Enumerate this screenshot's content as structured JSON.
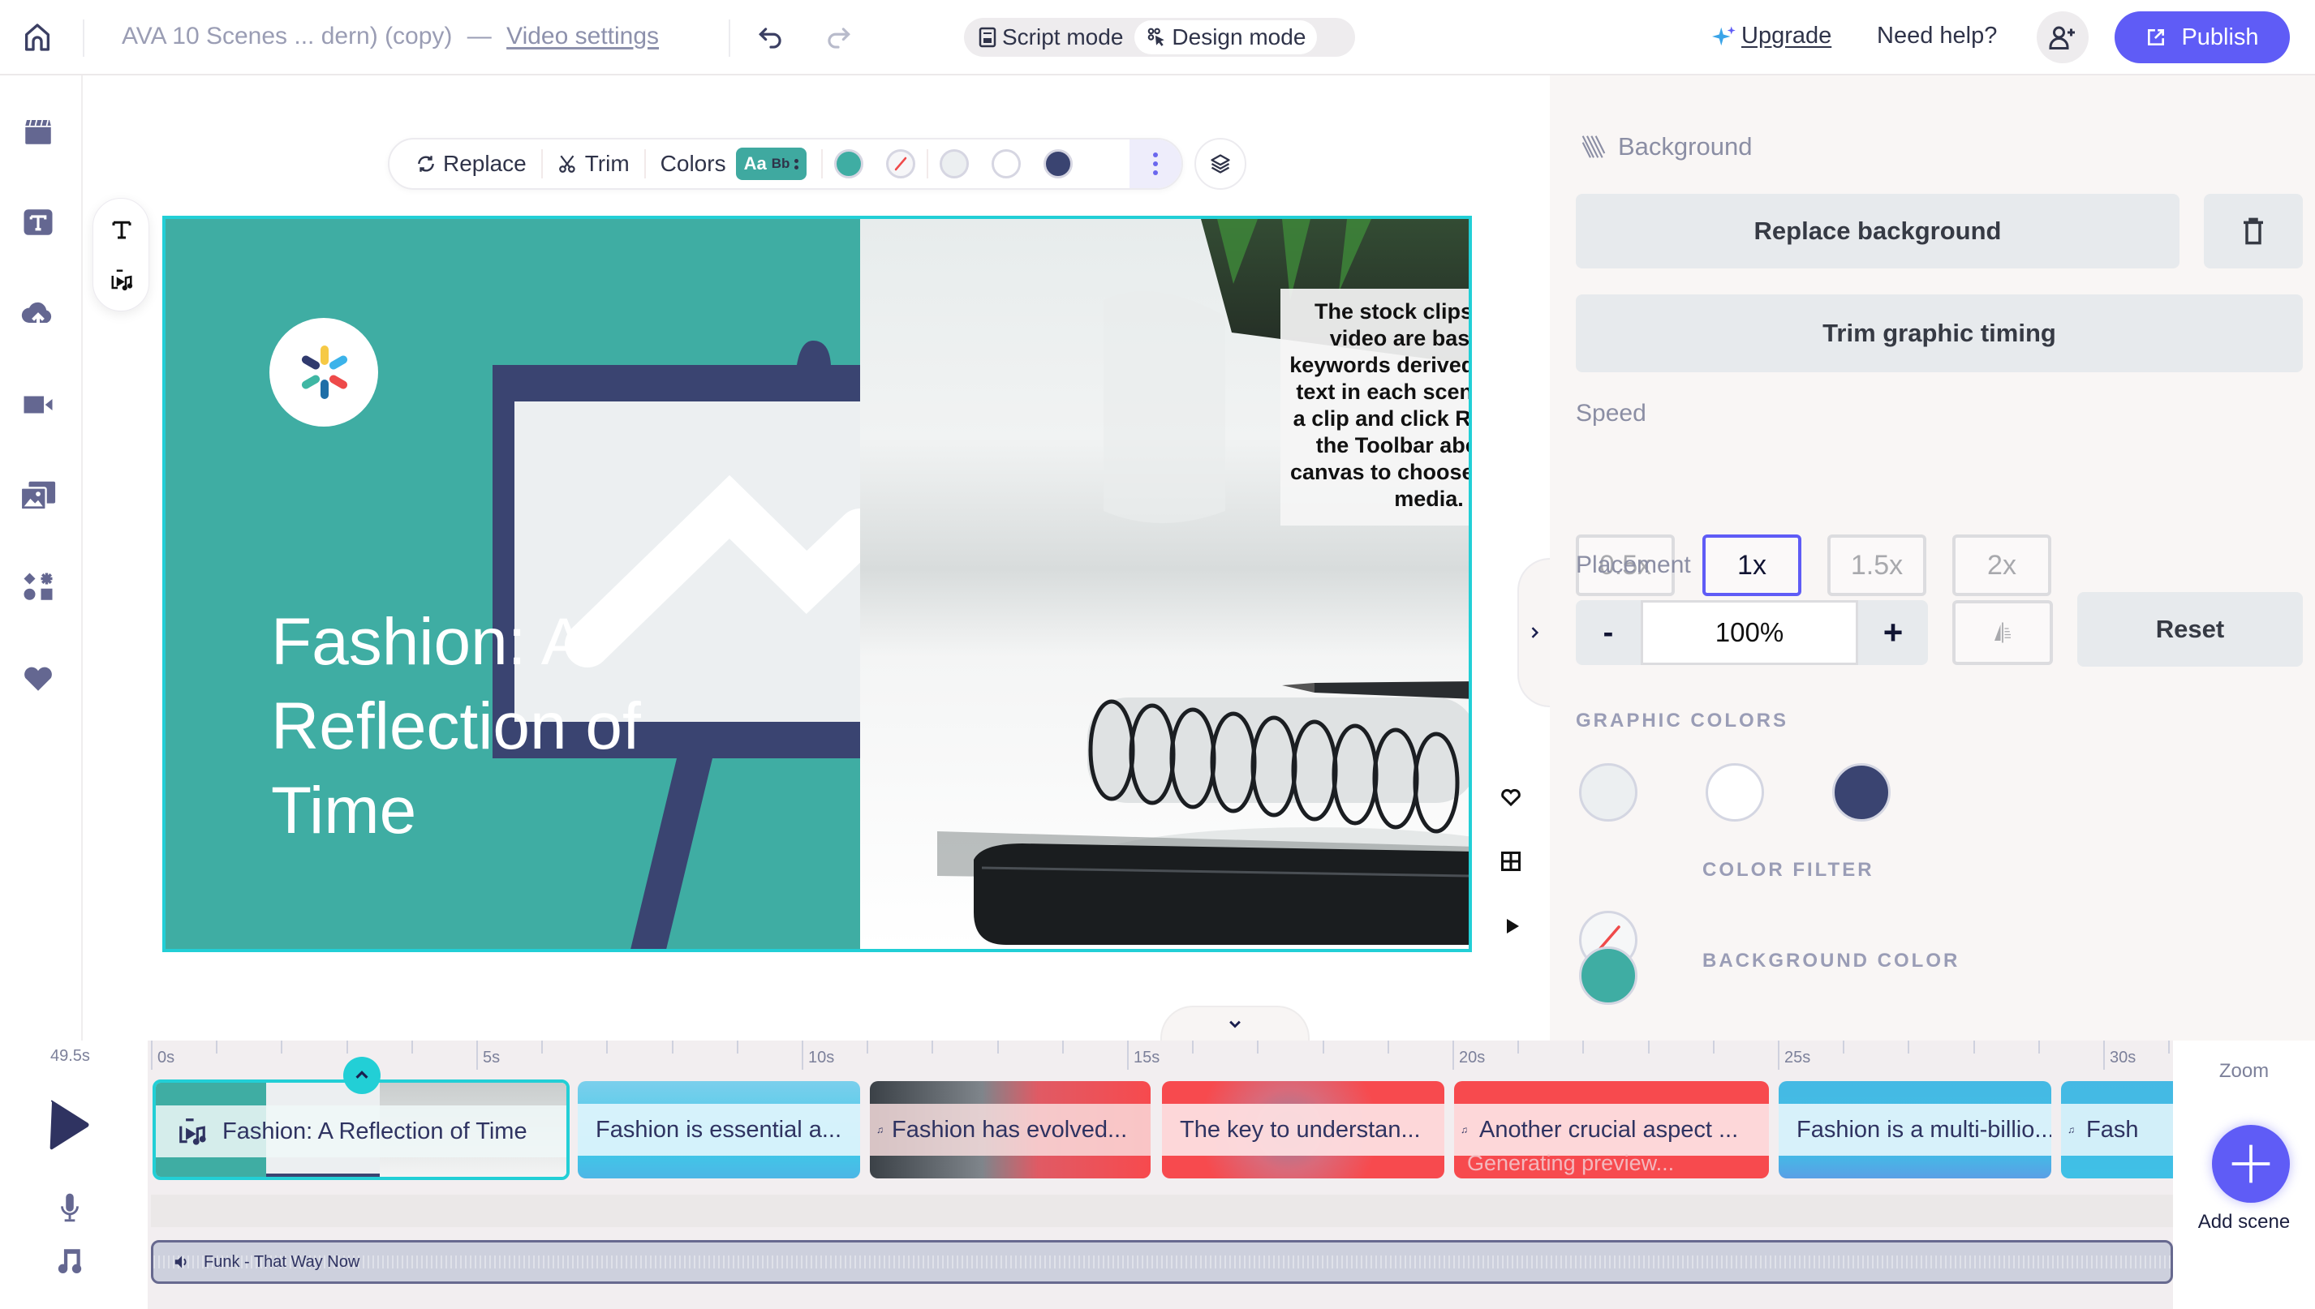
{
  "header": {
    "project_title": "AVA 10 Scenes ... dern) (copy)",
    "separator": "—",
    "video_settings_link": "Video settings",
    "modes": [
      {
        "label": "Script mode",
        "active": false
      },
      {
        "label": "Design mode",
        "active": true
      }
    ],
    "upgrade_label": "Upgrade",
    "help_label": "Need help?",
    "publish_label": "Publish",
    "colors": {
      "accent": "#5f5cf6",
      "publish_bg": "#5f5cf6"
    }
  },
  "sidebar": {
    "items": [
      {
        "name": "scenes",
        "icon": "clapperboard-icon"
      },
      {
        "name": "text",
        "icon": "text-box-icon"
      },
      {
        "name": "uploads",
        "icon": "cloud-upload-icon"
      },
      {
        "name": "video",
        "icon": "video-camera-icon"
      },
      {
        "name": "media",
        "icon": "image-film-icon"
      },
      {
        "name": "elements",
        "icon": "shapes-icon"
      },
      {
        "name": "favorites",
        "icon": "heart-icon"
      }
    ]
  },
  "toolbar": {
    "replace_label": "Replace",
    "trim_label": "Trim",
    "colors_label": "Colors",
    "font_chip": {
      "aa": "Aa",
      "bb": "Bb"
    },
    "swatches": [
      "#3fada3",
      "none",
      "#eceff1",
      "#ffffff",
      "#3a4471"
    ]
  },
  "canvas": {
    "title_lines": [
      "Fashion: A",
      "Reflection of",
      "Time"
    ],
    "note": "The stock clips in this video are based on keywords derived from the text in each scene. Select a clip and click Replace in the Toolbar above the canvas to choose different media.",
    "background_color": "#3fada3",
    "selection_color": "#22cfd6"
  },
  "panel": {
    "section_title": "Background",
    "replace_background_label": "Replace background",
    "trim_graphic_timing_label": "Trim graphic timing",
    "speed_label": "Speed",
    "speed_options": [
      "0.5x",
      "1x",
      "1.5x",
      "2x"
    ],
    "speed_selected": "1x",
    "placement_label": "Placement",
    "placement_value": "100%",
    "minus_label": "-",
    "plus_label": "+",
    "reset_label": "Reset",
    "graphic_colors_label": "GRAPHIC COLORS",
    "graphic_colors": [
      "#eceff1",
      "#ffffff",
      "#3a4471"
    ],
    "color_filter_label": "COLOR FILTER",
    "background_color_label": "BACKGROUND COLOR",
    "background_color": "#3fada3"
  },
  "timeline": {
    "duration": "49.5s",
    "ruler_labels": [
      "0s",
      "5s",
      "10s",
      "15s",
      "20s",
      "25s",
      "30s"
    ],
    "scenes": [
      {
        "label": "Fashion: A Reflection of Time",
        "selected": true,
        "has_icon": true
      },
      {
        "label": "Fashion is essential a...",
        "selected": false,
        "has_icon": false
      },
      {
        "label": "Fashion has evolved...",
        "selected": false,
        "has_icon": true
      },
      {
        "label": "The key to understan...",
        "selected": false,
        "has_icon": false
      },
      {
        "label": "Another crucial aspect ...",
        "selected": false,
        "has_icon": true,
        "status": "Generating preview..."
      },
      {
        "label": "Fashion is a multi-billio...",
        "selected": false,
        "has_icon": false
      },
      {
        "label": "Fash",
        "selected": false,
        "has_icon": true
      }
    ],
    "music_track": "Funk - That Way Now",
    "zoom_label": "Zoom",
    "add_scene_label": "Add scene"
  }
}
